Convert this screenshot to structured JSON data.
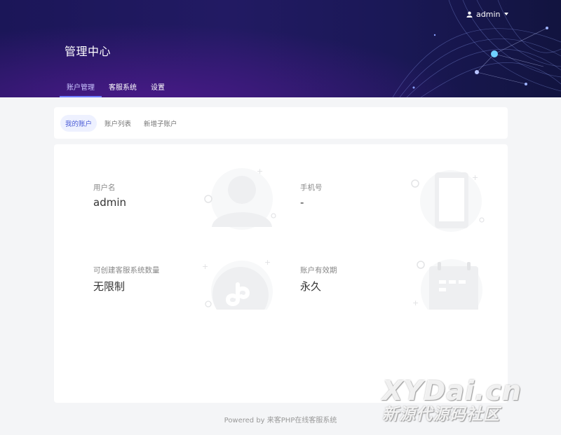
{
  "header": {
    "user_name": "admin",
    "page_title": "管理中心",
    "nav_tabs": [
      {
        "label": "账户管理",
        "active": true
      },
      {
        "label": "客服系统",
        "active": false
      },
      {
        "label": "设置",
        "active": false
      }
    ]
  },
  "subnav": {
    "tabs": [
      {
        "label": "我的账户",
        "active": true
      },
      {
        "label": "账户列表",
        "active": false
      },
      {
        "label": "新增子账户",
        "active": false
      }
    ]
  },
  "account": {
    "username_label": "用户名",
    "username_value": "admin",
    "phone_label": "手机号",
    "phone_value": "-",
    "quota_label": "可创建客服系统数量",
    "quota_value": "无限制",
    "validity_label": "账户有效期",
    "validity_value": "永久"
  },
  "icons": {
    "user": "user-icon",
    "caret": "caret-down-icon",
    "avatar": "person-illustration-icon",
    "phone": "phone-illustration-icon",
    "app": "mini-program-illustration-icon",
    "calendar": "calendar-illustration-icon"
  },
  "footer": {
    "text": "Powered by 来客PHP在线客服系统"
  },
  "watermark": {
    "line1": "XYDai.cn",
    "line2": "新源代源码社区"
  },
  "colors": {
    "header_dark": "#1b1658",
    "header_purple": "#4b1a8a",
    "active_tab": "#6f7cff",
    "illustration_gray": "#eeeff1"
  }
}
